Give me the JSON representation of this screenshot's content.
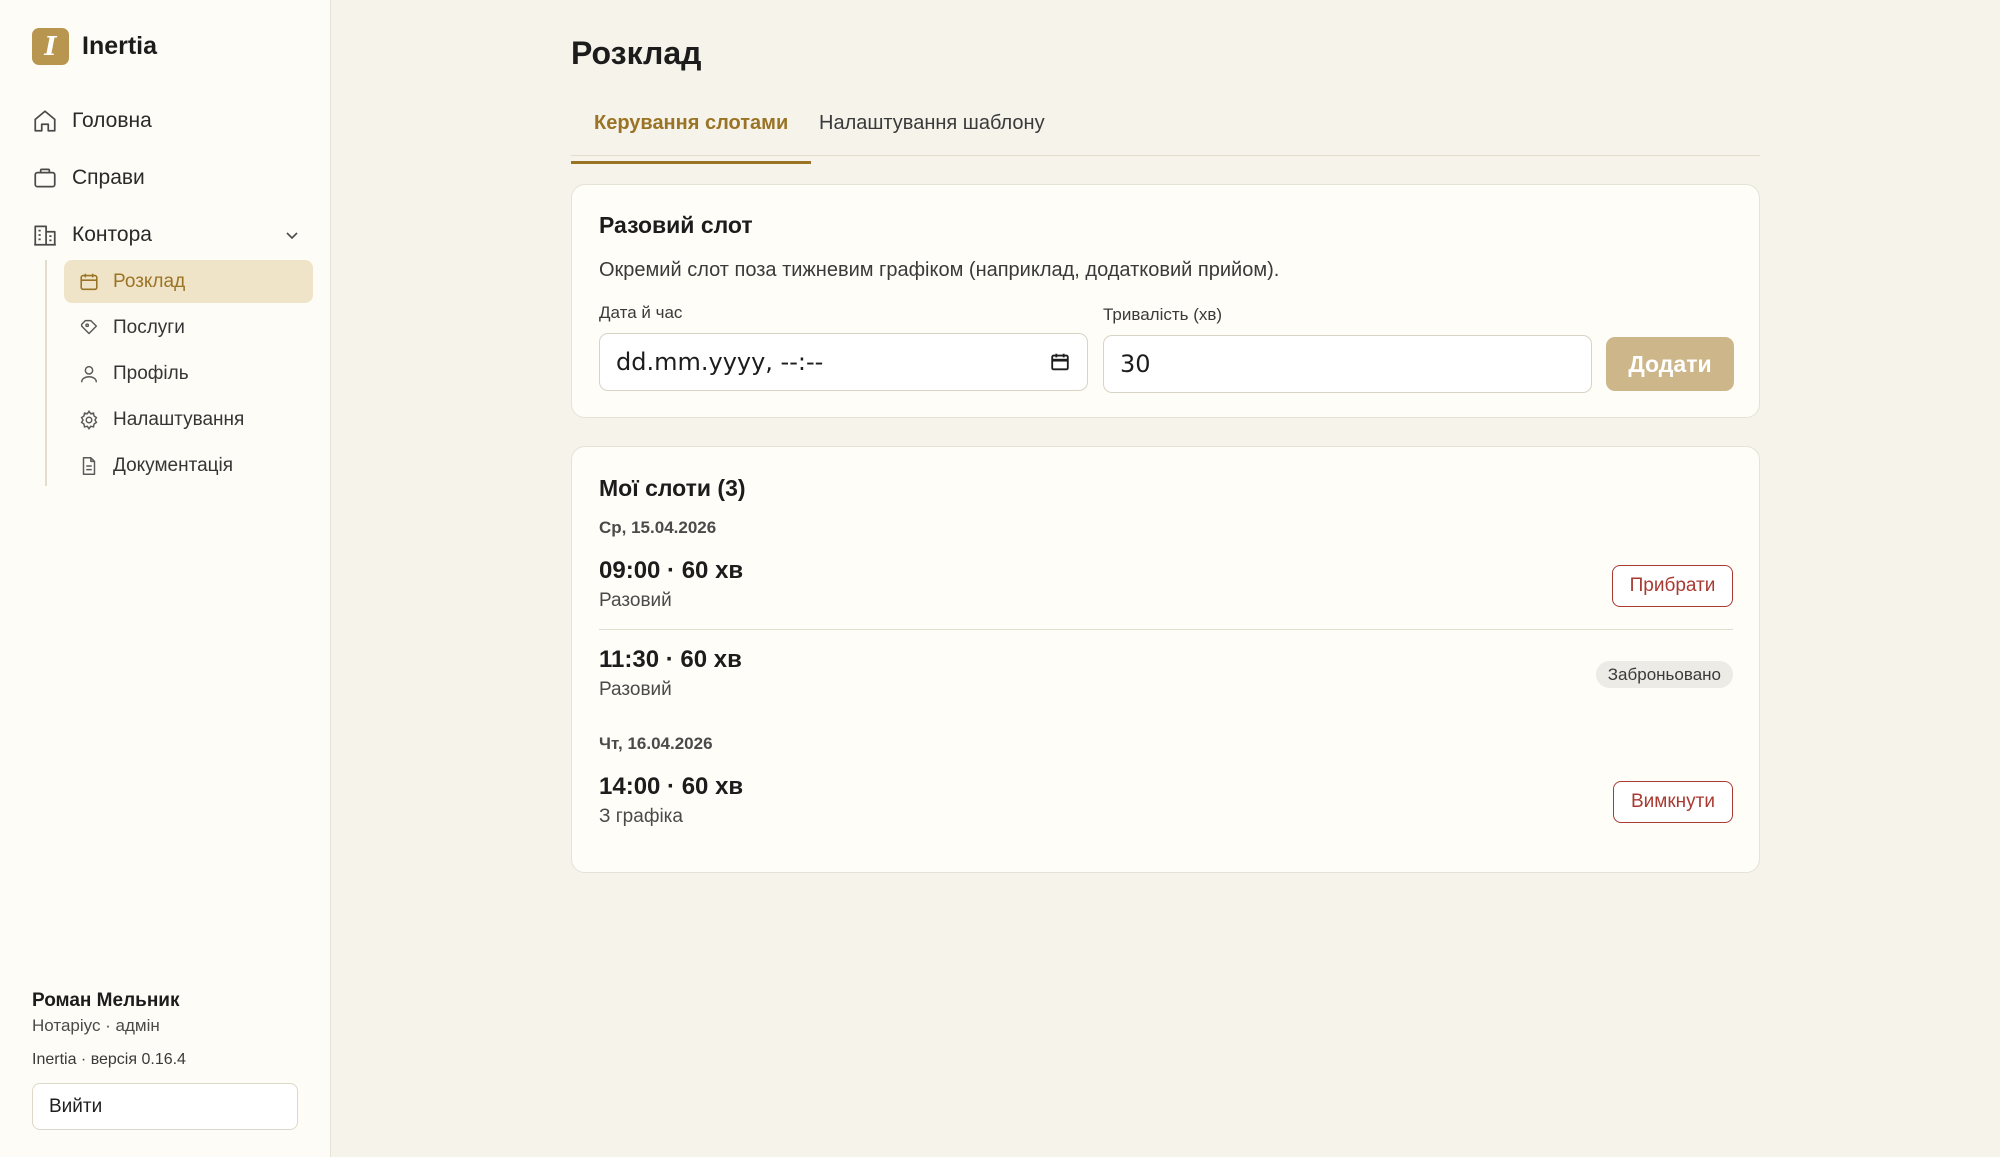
{
  "brand": {
    "logo_letter": "I",
    "name": "Inertia",
    "accent": "#b8964f"
  },
  "nav": {
    "top": [
      {
        "label": "Головна",
        "icon": "home-icon"
      },
      {
        "label": "Справи",
        "icon": "briefcase-icon"
      },
      {
        "label": "Контора",
        "icon": "building-icon",
        "expanded": true
      }
    ],
    "sub": [
      {
        "label": "Розклад",
        "icon": "calendar-icon",
        "active": true
      },
      {
        "label": "Послуги",
        "icon": "tag-icon"
      },
      {
        "label": "Профіль",
        "icon": "user-icon"
      },
      {
        "label": "Налаштування",
        "icon": "gear-icon"
      },
      {
        "label": "Документація",
        "icon": "document-icon"
      }
    ]
  },
  "user": {
    "name": "Роман Мельник",
    "role": "Нотаріус · адмін"
  },
  "app_version": "Inertia · версія 0.16.4",
  "logout_label": "Вийти",
  "page": {
    "title": "Розклад",
    "tabs": [
      {
        "label": "Керування слотами",
        "active": true
      },
      {
        "label": "Налаштування шаблону",
        "active": false
      }
    ]
  },
  "one_time": {
    "title": "Разовий слот",
    "description": "Окремий слот поза тижневим графіком (наприклад, додатковий прийом).",
    "datetime_label": "Дата й час",
    "datetime_placeholder": "dd.mm.yyyy, --:--",
    "duration_label": "Тривалість (хв)",
    "duration_value": "30",
    "add_label": "Додати"
  },
  "slots": {
    "title": "Мої слоти (3)",
    "groups": [
      {
        "date": "Ср, 15.04.2026",
        "items": [
          {
            "time": "09:00 · 60 хв",
            "type": "Разовий",
            "action": "Прибрати"
          },
          {
            "time": "11:30 · 60 хв",
            "type": "Разовий",
            "badge": "Заброньовано"
          }
        ]
      },
      {
        "date": "Чт, 16.04.2026",
        "items": [
          {
            "time": "14:00 · 60 хв",
            "type": "З графіка",
            "action": "Вимкнути"
          }
        ]
      }
    ]
  },
  "colors": {
    "accent": "#9a7325",
    "danger": "#a83a32",
    "active_bg": "#f0e4c8"
  }
}
